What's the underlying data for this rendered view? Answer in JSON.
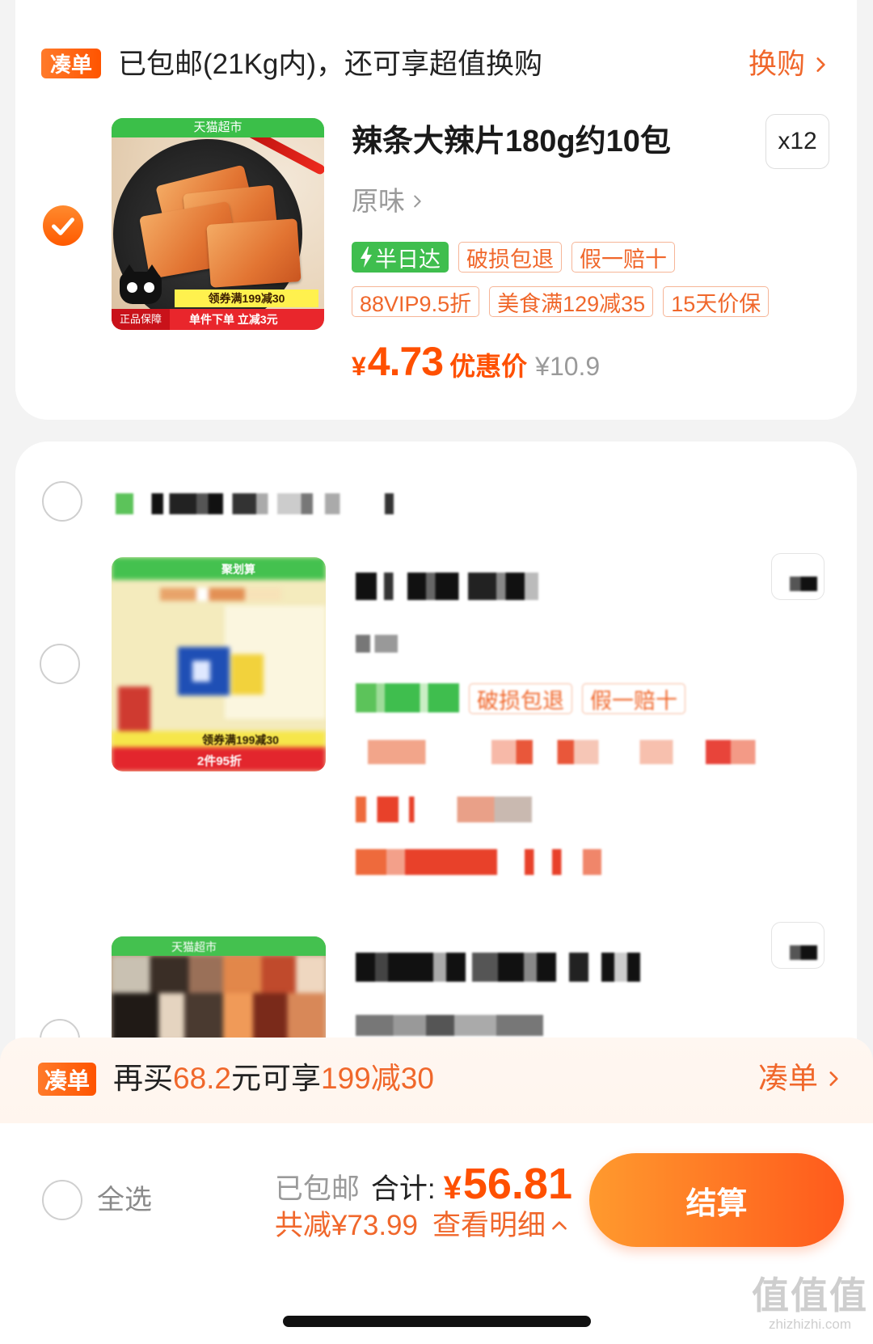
{
  "colors": {
    "accent": "#ff5000",
    "accent_soft": "#f0672b",
    "tag_border": "#f6b597",
    "green": "#3dbd4d",
    "muted": "#999999",
    "text": "#1f1f1f",
    "page_bg": "#f3f3f3",
    "banner_bg": "#fff5ee"
  },
  "card1": {
    "promo": {
      "badge": "凑单",
      "text": "已包邮(21Kg内)，还可享超值换购",
      "link": "换购",
      "link_icon": "chevron-right-icon"
    },
    "item": {
      "selected": true,
      "image": {
        "store_label": "天猫超市",
        "coupon": "领券满199减30",
        "guarantee": "正品保障",
        "promo": "单件下单 立减3元"
      },
      "title": "辣条大辣片180g约10包",
      "quantity": "x12",
      "variant": "原味",
      "tags_row1": [
        {
          "label": "半日达",
          "icon": "lightning-icon",
          "style": "filled-green"
        },
        {
          "label": "破损包退"
        },
        {
          "label": "假一赔十"
        }
      ],
      "tags_row2": [
        {
          "label": "88VIP9.5折"
        },
        {
          "label": "美食满129减35"
        },
        {
          "label": "15天价保"
        }
      ],
      "price": {
        "currency": "¥",
        "amount": "4.73",
        "label": "优惠价",
        "original": "¥10.9"
      }
    }
  },
  "card2": {
    "store_selected": false,
    "items": [
      {
        "selected": false,
        "image": {
          "label": "聚划算",
          "coupon": "领券满199减30",
          "promo": "2件95折"
        },
        "tags": [
          "破损包退",
          "假一赔十"
        ]
      },
      {
        "selected": false,
        "image": {
          "label": "天猫超市"
        }
      }
    ]
  },
  "banner": {
    "badge": "凑单",
    "text_prefix": "再买",
    "amount": "68.2",
    "text_mid": "元可享",
    "offer": "199减30",
    "link": "凑单"
  },
  "footer": {
    "select_all_checked": false,
    "select_all": "全选",
    "shipping": "已包邮",
    "total_label": "合计:",
    "currency": "¥",
    "total": "56.81",
    "savings_label": "共减",
    "savings": "¥73.99",
    "details_link": "查看明细",
    "checkout": "结算"
  },
  "watermark": {
    "mark": "值值值",
    "domain": "zhizhizhi.com"
  }
}
